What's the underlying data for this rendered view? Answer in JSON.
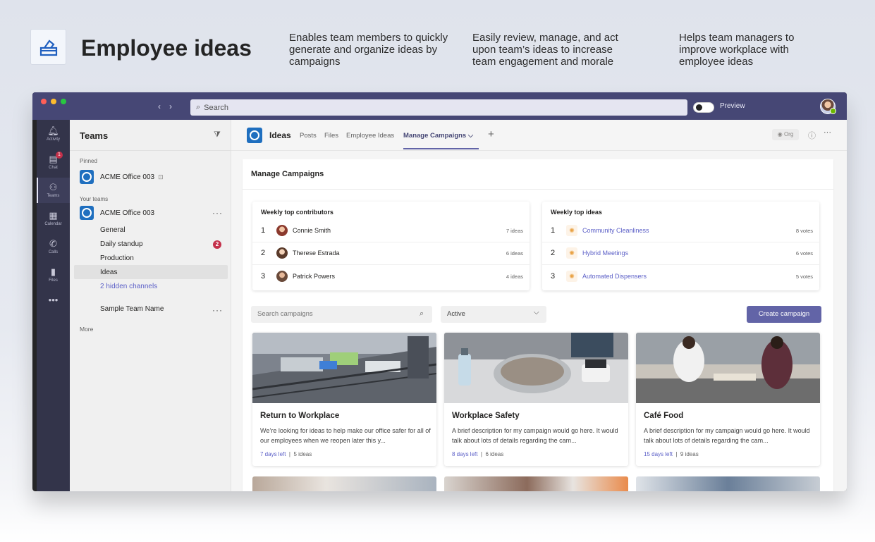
{
  "hero": {
    "title": "Employee ideas",
    "desc1": "Enables team members to quickly generate and organize ideas by campaigns",
    "desc2": "Easily review, manage, and act upon team’s ideas to increase team engagement and morale",
    "desc3": "Helps team managers to improve workplace with employee ideas"
  },
  "titlebar": {
    "search_placeholder": "Search",
    "preview_label": "Preview"
  },
  "rail": {
    "items": [
      {
        "label": "Activity",
        "icon": "bell-icon"
      },
      {
        "label": "Chat",
        "icon": "chat-icon",
        "badge": "1"
      },
      {
        "label": "Teams",
        "icon": "teams-icon"
      },
      {
        "label": "Calendar",
        "icon": "calendar-icon"
      },
      {
        "label": "Calls",
        "icon": "phone-icon"
      },
      {
        "label": "Files",
        "icon": "file-icon"
      }
    ]
  },
  "teams": {
    "title": "Teams",
    "pinned_label": "Pinned",
    "pinned_team": "ACME Office 003",
    "your_teams_label": "Your teams",
    "team": "ACME Office 003",
    "channels": [
      "General",
      "Daily standup",
      "Production",
      "Ideas"
    ],
    "standup_badge": "2",
    "hidden_channels": "2 hidden channels",
    "sample_team": "Sample Team Name",
    "more": "More"
  },
  "app": {
    "name": "Ideas",
    "tabs": [
      "Posts",
      "Files",
      "Employee Ideas",
      "Manage Campaigns"
    ],
    "org_label": "Org"
  },
  "content": {
    "title": "Manage Campaigns",
    "contributors": {
      "title": "Weekly top contributors",
      "rows": [
        {
          "rank": "1",
          "name": "Connie Smith",
          "count": "7 ideas"
        },
        {
          "rank": "2",
          "name": "Therese Estrada",
          "count": "6 ideas"
        },
        {
          "rank": "3",
          "name": "Patrick Powers",
          "count": "4 ideas"
        }
      ]
    },
    "ideas": {
      "title": "Weekly top ideas",
      "rows": [
        {
          "rank": "1",
          "name": "Community Cleanliness",
          "count": "8 votes"
        },
        {
          "rank": "2",
          "name": "Hybrid Meetings",
          "count": "6 votes"
        },
        {
          "rank": "3",
          "name": "Automated Dispensers",
          "count": "5 votes"
        }
      ]
    },
    "search_placeholder": "Search campaigns",
    "status_value": "Active",
    "create_label": "Create campaign",
    "campaigns": [
      {
        "title": "Return to Workplace",
        "desc": "We’re looking for ideas to help make our office safer for all of our employees when we reopen later this y...",
        "days": "7 days left",
        "ideas": "5 ideas"
      },
      {
        "title": "Workplace Safety",
        "desc": "A brief description for my campaign would go here. It would talk about lots of details regarding the cam...",
        "days": "8 days left",
        "ideas": "6 ideas"
      },
      {
        "title": "Café Food",
        "desc": "A brief description for my campaign would go here. It would talk about lots of details regarding the cam...",
        "days": "15 days left",
        "ideas": "9 ideas"
      }
    ]
  },
  "colors": {
    "accent": "#6264a7",
    "titlebar": "#464775",
    "rail": "#33344a",
    "badge": "#c4314b"
  }
}
